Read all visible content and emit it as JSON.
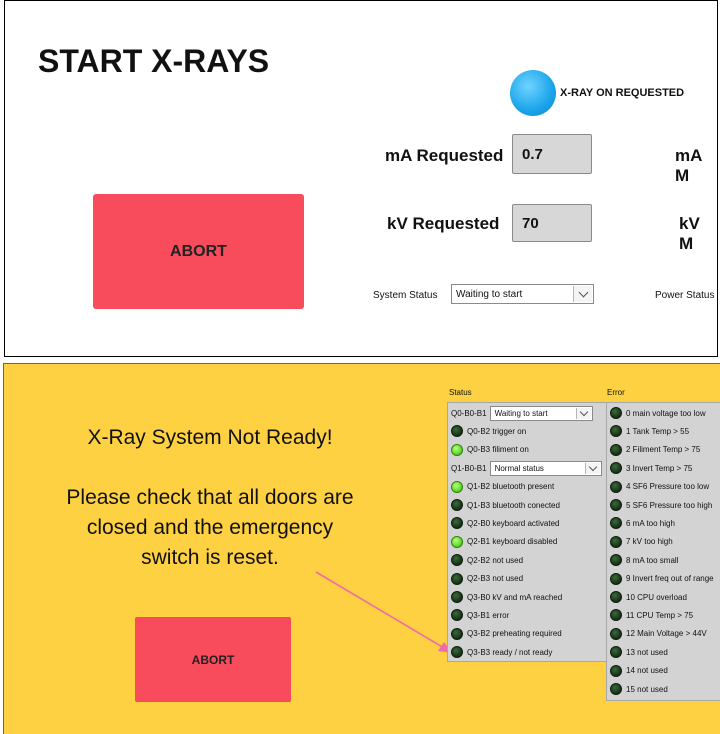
{
  "top": {
    "title": "START X-RAYS",
    "xray_on_label": "X-RAY ON REQUESTED",
    "ma_requested_label": "mA Requested",
    "ma_requested_value": "0.7",
    "kv_requested_label": "kV Requested",
    "kv_requested_value": "70",
    "ma_measured_label": "mA M",
    "kv_measured_label": "kV M",
    "abort_label": "ABORT",
    "system_status_label": "System Status",
    "system_status_value": "Waiting to start",
    "power_status_label": "Power Status",
    "xray_led_color": "#1ba4ea",
    "abort_color": "#f84b5b"
  },
  "bottom": {
    "message_line1": "X-Ray System Not Ready!",
    "message_line2": "Please check that all doors are",
    "message_line3": "closed and the emergency",
    "message_line4": "switch is reset.",
    "abort_label": "ABORT",
    "background_color": "#fdd142",
    "status_title": "Status",
    "error_title": "Error",
    "status_rows": [
      {
        "type": "select",
        "label": "Q0-B0-B1",
        "value": "Waiting to start"
      },
      {
        "type": "led",
        "label": "Q0-B2 trigger on",
        "on": false
      },
      {
        "type": "led",
        "label": "Q0-B3 filiment on",
        "on": true
      },
      {
        "type": "select",
        "label": "Q1-B0-B1",
        "value": "Normal status"
      },
      {
        "type": "led",
        "label": "Q1-B2 bluetooth present",
        "on": true
      },
      {
        "type": "led",
        "label": "Q1-B3 bluetooth conected",
        "on": false
      },
      {
        "type": "led",
        "label": "Q2-B0 keyboard activated",
        "on": false
      },
      {
        "type": "led",
        "label": "Q2-B1 keyboard disabled",
        "on": true
      },
      {
        "type": "led",
        "label": "Q2-B2 not used",
        "on": false
      },
      {
        "type": "led",
        "label": "Q2-B3 not used",
        "on": false
      },
      {
        "type": "led",
        "label": "Q3-B0 kV and mA reached",
        "on": false
      },
      {
        "type": "led",
        "label": "Q3-B1 error",
        "on": false
      },
      {
        "type": "led",
        "label": "Q3-B2 preheating required",
        "on": false
      },
      {
        "type": "led",
        "label": "Q3-B3 ready / not ready",
        "on": false
      }
    ],
    "error_rows": [
      {
        "label": "0 main voltage too low",
        "on": false
      },
      {
        "label": "1 Tank Temp > 55",
        "on": false
      },
      {
        "label": "2 Filiment Temp > 75",
        "on": false
      },
      {
        "label": "3 Invert Temp > 75",
        "on": false
      },
      {
        "label": "4 SF6 Pressure too low",
        "on": false
      },
      {
        "label": "5 SF6 Pressure too high",
        "on": false
      },
      {
        "label": "6 mA too high",
        "on": false
      },
      {
        "label": "7 kV too high",
        "on": false
      },
      {
        "label": "8 mA too small",
        "on": false
      },
      {
        "label": "9 Invert freq out of range",
        "on": false
      },
      {
        "label": "10 CPU overload",
        "on": false
      },
      {
        "label": "11 CPU Temp > 75",
        "on": false
      },
      {
        "label": "12 Main Voltage > 44V",
        "on": false
      },
      {
        "label": "13 not used",
        "on": false
      },
      {
        "label": "14 not used",
        "on": false
      },
      {
        "label": "15 not used",
        "on": false
      }
    ]
  }
}
